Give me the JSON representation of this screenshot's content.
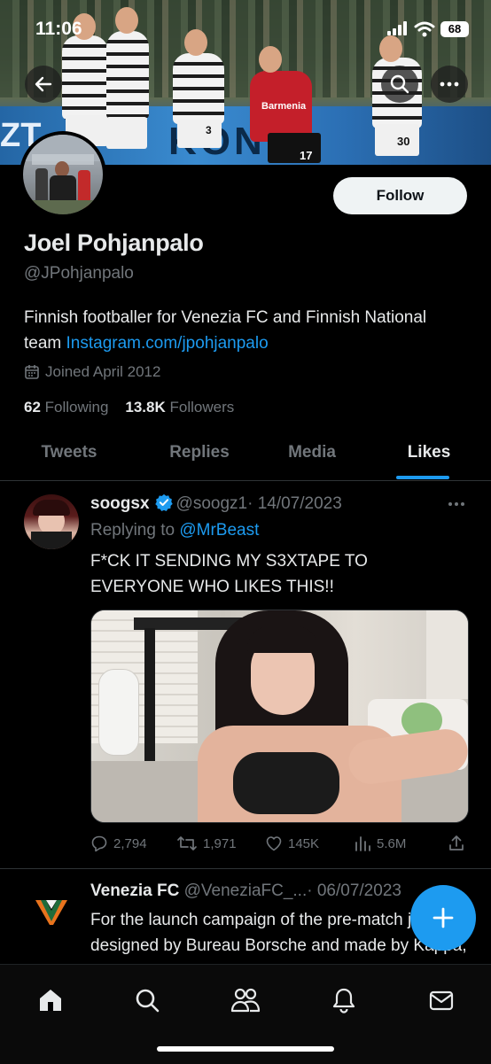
{
  "status_bar": {
    "time": "11:06",
    "battery": "68"
  },
  "profile": {
    "name": "Joel Pohjanpalo",
    "handle": "@JPohjanpalo",
    "bio_text": "Finnish footballer for Venezia FC and Finnish National team",
    "bio_link": "Instagram.com/jpohjanpalo",
    "joined": "Joined April 2012",
    "following_count": "62",
    "following_label": "Following",
    "followers_count": "13.8K",
    "followers_label": "Followers",
    "follow_button": "Follow"
  },
  "banner": {
    "board_text": "KON",
    "board_left": "ZT",
    "sponsor": "Barmenia",
    "jersey_numbers": [
      "3",
      "17",
      "30"
    ]
  },
  "tabs": [
    {
      "label": "Tweets",
      "active": false
    },
    {
      "label": "Replies",
      "active": false
    },
    {
      "label": "Media",
      "active": false
    },
    {
      "label": "Likes",
      "active": true
    }
  ],
  "tweets": [
    {
      "name": "soogsx",
      "verified": true,
      "handle": "@soogz1",
      "date": "· 14/07/2023",
      "replying_prefix": "Replying to",
      "replying_to": "@MrBeast",
      "text": "F*CK IT SENDING MY S3XTAPE TO EVERYONE WHO LIKES THIS!!",
      "replies": "2,794",
      "retweets": "1,971",
      "likes": "145K",
      "views": "5.6M"
    },
    {
      "name": "Venezia FC",
      "handle": "@VeneziaFC_...",
      "date": "· 06/07/2023",
      "text": "For the launch campaign of the pre-match jersey designed by Bureau Borsche and made by Kappa, Venezia FC pays tribute to"
    }
  ],
  "colors": {
    "accent": "#1d9bf0",
    "text_primary": "#e7e9ea",
    "text_secondary": "#71767b",
    "background": "#000000"
  }
}
